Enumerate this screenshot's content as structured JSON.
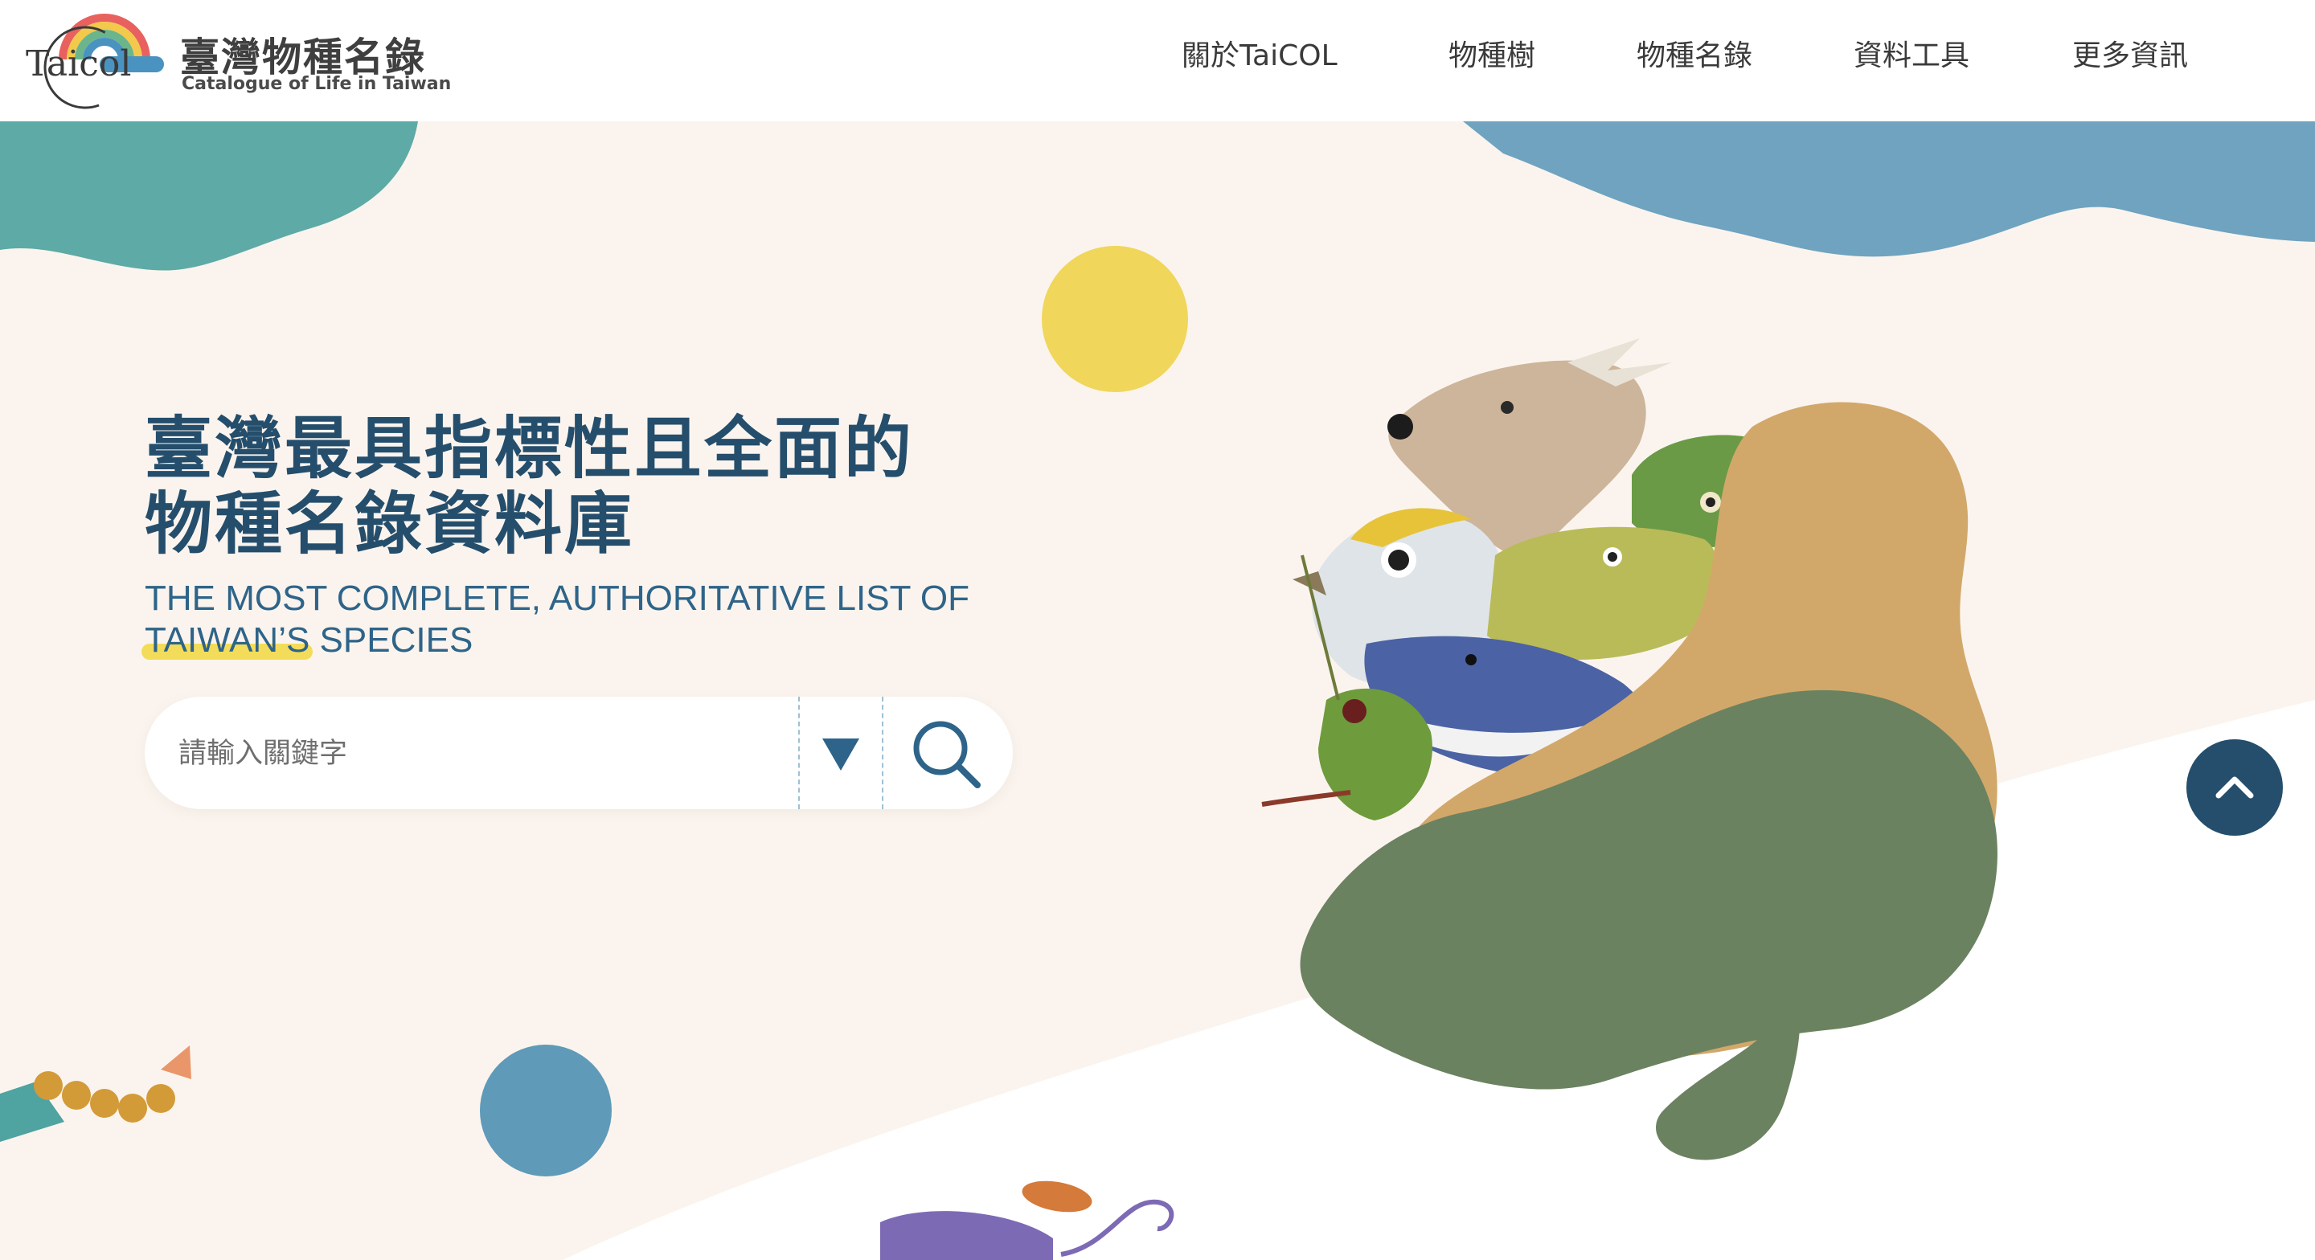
{
  "header": {
    "logo": {
      "mark_text": "Taicol",
      "title": "臺灣物種名錄",
      "subtitle": "Catalogue of Life in Taiwan"
    },
    "nav": [
      {
        "label": "關於TaiCOL"
      },
      {
        "label": "物種樹"
      },
      {
        "label": "物種名錄"
      },
      {
        "label": "資料工具"
      },
      {
        "label": "更多資訊"
      }
    ]
  },
  "hero": {
    "headline_line1": "臺灣最具指標性且全面的",
    "headline_line2": "物種名錄資料庫",
    "subtitle_line1": "THE MOST COMPLETE, AUTHORITATIVE LIST OF",
    "subtitle_line2_highlight": "TAIWAN’S",
    "subtitle_line2_rest": " SPECIES"
  },
  "search": {
    "placeholder": "請輸入關鍵字",
    "value": ""
  },
  "colors": {
    "primary": "#244e6c",
    "accent_yellow": "#f3dc5a",
    "teal": "#4fa3a0",
    "blue": "#5f9ab9",
    "green": "#6b8260",
    "sand": "#d2a86a",
    "background": "#fbf4ee"
  },
  "icons": {
    "filter": "triangle-down-icon",
    "search": "magnifier-icon",
    "back_to_top": "chevron-up-icon"
  }
}
